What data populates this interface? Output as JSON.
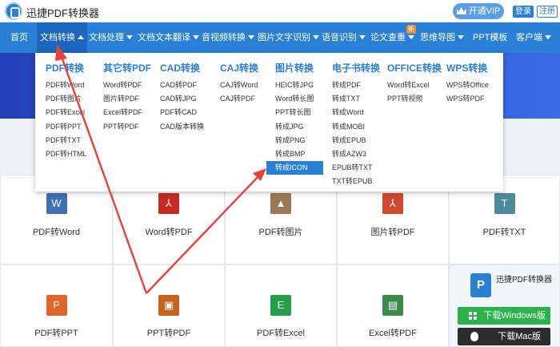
{
  "app": {
    "title": "迅捷PDF转换器"
  },
  "account": {
    "vip_label": "开通VIP",
    "login_label": "登录",
    "register_label": "注册"
  },
  "nav": {
    "items": [
      {
        "label": "首页"
      },
      {
        "label": "文档转换"
      },
      {
        "label": "文档处理"
      },
      {
        "label": "文档文本翻译"
      },
      {
        "label": "音视频转换"
      },
      {
        "label": "图片文字识别"
      },
      {
        "label": "语音识别"
      },
      {
        "label": "论文查重"
      },
      {
        "label": "思维导图"
      },
      {
        "label": "PPT模板"
      },
      {
        "label": "客户端"
      }
    ],
    "new_badge": "新",
    "active_index": 1
  },
  "dropdown": {
    "columns": [
      {
        "title": "PDF转换",
        "items": [
          "PDF转Word",
          "PDF转图片",
          "PDF转Excel",
          "PDF转PPT",
          "PDF转TXT",
          "PDF转HTML"
        ]
      },
      {
        "title": "其它转PDF",
        "items": [
          "Word转PDF",
          "图片转PDF",
          "Excel转PDF",
          "PPT转PDF"
        ]
      },
      {
        "title": "CAD转换",
        "items": [
          "CAD转PDF",
          "CAD转JPG",
          "PDF转CAD",
          "CAD版本转换"
        ]
      },
      {
        "title": "CAJ转换",
        "items": [
          "CAJ转Word",
          "CAJ转PDF"
        ]
      },
      {
        "title": "图片转换",
        "items": [
          "HEIC转JPG",
          "Word转长图",
          "PPT转长图",
          "转成JPG",
          "转成PNG",
          "转成BMP",
          "转成ICON"
        ],
        "highlighted_index": 6
      },
      {
        "title": "电子书转换",
        "items": [
          "转成PDF",
          "转成TXT",
          "转成Word",
          "转成MOBI",
          "转成EPUB",
          "转成AZW3",
          "EPUB转TXT",
          "TXT转EPUB"
        ]
      },
      {
        "title": "OFFICE转换",
        "items": [
          "Word转Excel",
          "PPT转视频"
        ]
      },
      {
        "title": "WPS转换",
        "items": [
          "WPS转Office",
          "WPS转PDF"
        ]
      }
    ]
  },
  "tools": [
    {
      "label": "PDF转Word",
      "icon": "W",
      "icon_name": "word-icon",
      "color": "#3f6fb5"
    },
    {
      "label": "Word转PDF",
      "icon": "⅄",
      "icon_name": "pdf-icon",
      "color": "#c8281e"
    },
    {
      "label": "PDF转图片",
      "icon": "▲",
      "icon_name": "image-icon",
      "color": "#9a7a56"
    },
    {
      "label": "图片转PDF",
      "icon": "⅄",
      "icon_name": "pdf-icon",
      "color": "#d1492e"
    },
    {
      "label": "PDF转TXT",
      "icon": "T",
      "icon_name": "txt-icon",
      "color": "#4d8b9c"
    },
    {
      "label": "PDF转PPT",
      "icon": "P",
      "icon_name": "ppt-icon",
      "color": "#e0652a"
    },
    {
      "label": "PPT转PDF",
      "icon": "▣",
      "icon_name": "ppt-icon",
      "color": "#c8621f"
    },
    {
      "label": "PDF转Excel",
      "icon": "E",
      "icon_name": "excel-icon",
      "color": "#25a04a"
    },
    {
      "label": "Excel转PDF",
      "icon": "▤",
      "icon_name": "excel-icon",
      "color": "#3a8a4a"
    }
  ],
  "sidebar": {
    "logo_letter": "P",
    "title": "迅捷PDF转换器",
    "download_windows": "下载Windows版",
    "download_mac": "下载Mac版"
  },
  "colors": {
    "brand": "#2a7fd6",
    "arrow": "#e8413b",
    "highlight": "#2a7fd6"
  }
}
